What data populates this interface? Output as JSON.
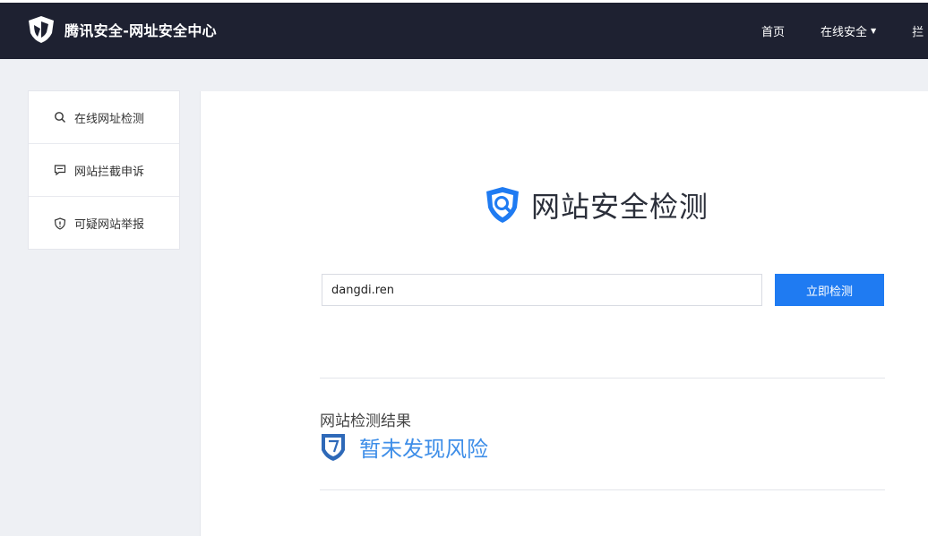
{
  "header": {
    "brand_title": "腾讯安全-网址安全中心",
    "nav": [
      {
        "label": "首页"
      },
      {
        "label": "在线安全"
      },
      {
        "label": "拦"
      }
    ]
  },
  "sidebar": {
    "items": [
      {
        "label": "在线网址检测",
        "icon": "search-icon"
      },
      {
        "label": "网站拦截申诉",
        "icon": "chat-icon"
      },
      {
        "label": "可疑网站举报",
        "icon": "shield-alert-icon"
      }
    ]
  },
  "main": {
    "title": "网站安全检测",
    "url_value": "dangdi.ren",
    "check_button": "立即检测",
    "result_label": "网站检测结果",
    "result_status": "暂未发现风险"
  },
  "colors": {
    "topbar": "#1e2131",
    "accent": "#1f7bf2",
    "result": "#3e8ee8"
  }
}
